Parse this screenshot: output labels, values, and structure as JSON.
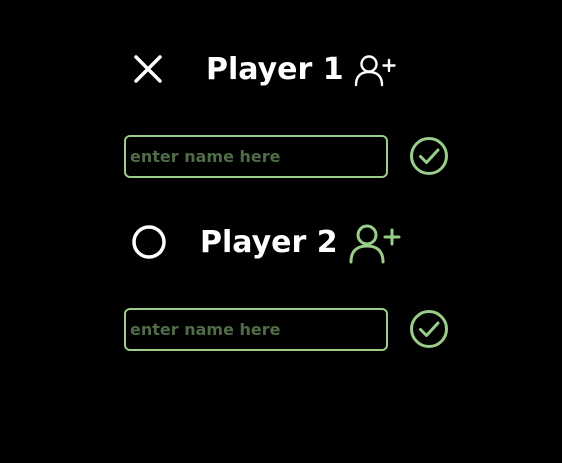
{
  "players": [
    {
      "symbol_icon": "x-mark-icon",
      "title": "Player 1",
      "add_icon": "add-user-icon",
      "name_input": {
        "value": "",
        "placeholder": "enter name here"
      },
      "confirm_icon": "check-circle-icon"
    },
    {
      "symbol_icon": "circle-o-icon",
      "title": "Player 2",
      "add_icon": "add-user-icon",
      "name_input": {
        "value": "",
        "placeholder": "enter name here"
      },
      "confirm_icon": "check-circle-icon"
    }
  ],
  "colors": {
    "background": "#000000",
    "text": "#ffffff",
    "accent": "#9acd8a",
    "placeholder": "#4f6b47"
  }
}
